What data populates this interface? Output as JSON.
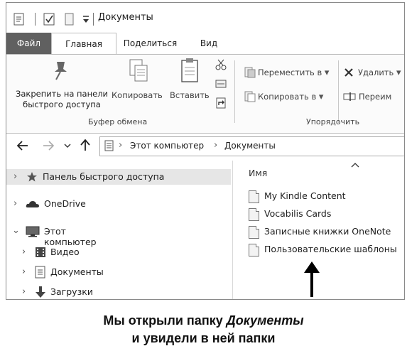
{
  "window": {
    "title": "Документы"
  },
  "tabs": [
    {
      "label": "Файл"
    },
    {
      "label": "Главная"
    },
    {
      "label": "Поделиться"
    },
    {
      "label": "Вид"
    }
  ],
  "ribbon": {
    "pin_label": "Закрепить на панели быстрого доступа",
    "pin_label_1": "Закрепить на панели",
    "pin_label_2": "быстрого доступа",
    "copy_label": "Копировать",
    "paste_label": "Вставить",
    "clipboard_group": "Буфер обмена",
    "move_to_label": "Переместить в",
    "copy_to_label": "Копировать в",
    "delete_label": "Удалить",
    "rename_label": "Переим",
    "organize_group": "Упорядочить"
  },
  "address": {
    "crumbs": [
      "Этот компьютер",
      "Документы"
    ]
  },
  "nav": {
    "items": [
      {
        "label": "Панель быстрого доступа",
        "icon": "star-icon"
      },
      {
        "label": "OneDrive",
        "icon": "cloud-icon"
      },
      {
        "label": "Этот компьютер",
        "icon": "computer-icon"
      },
      {
        "label": "Видео",
        "icon": "video-folder-icon"
      },
      {
        "label": "Документы",
        "icon": "documents-folder-icon"
      },
      {
        "label": "Загрузки",
        "icon": "downloads-folder-icon"
      }
    ]
  },
  "content": {
    "column_name": "Имя",
    "files": [
      {
        "name": "My Kindle Content"
      },
      {
        "name": "Vocabilis Cards"
      },
      {
        "name": "Записные книжки OneNote"
      },
      {
        "name": "Пользовательские шаблоны"
      }
    ]
  },
  "caption": {
    "line1_a": "Мы открыли папку ",
    "line1_b": "Документы",
    "line2": "и увидели в ней папки"
  }
}
